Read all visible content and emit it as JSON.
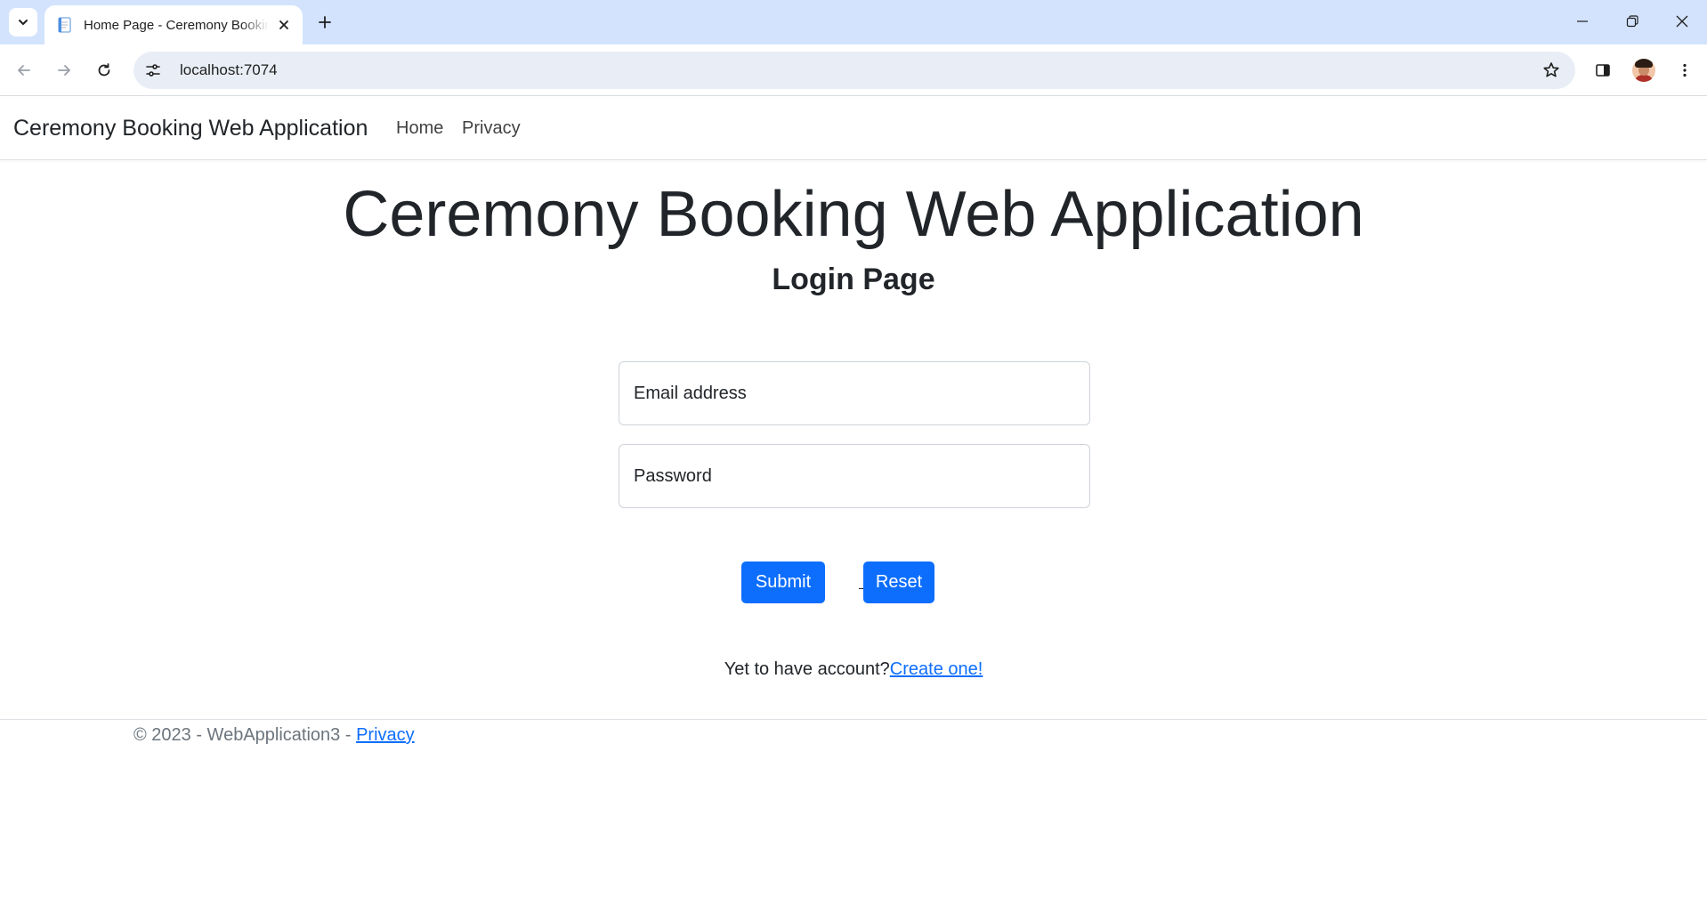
{
  "browser": {
    "tab_title": "Home Page - Ceremony Booking Web Application",
    "url": "localhost:7074"
  },
  "navbar": {
    "brand": "Ceremony Booking Web Application",
    "links": [
      "Home",
      "Privacy"
    ]
  },
  "main": {
    "title": "Ceremony Booking Web Application",
    "subtitle": "Login Page",
    "email_placeholder": "Email address",
    "password_placeholder": "Password",
    "submit_label": "Submit",
    "reset_label": "Reset",
    "signup_prompt": "Yet to have account?",
    "signup_link": "Create one!"
  },
  "footer": {
    "copyright": "© 2023 - WebApplication3 - ",
    "privacy_link": "Privacy"
  },
  "colors": {
    "primary": "#0d6efd",
    "tabstrip": "#d3e3fd",
    "omnibox": "#e9eef6"
  }
}
